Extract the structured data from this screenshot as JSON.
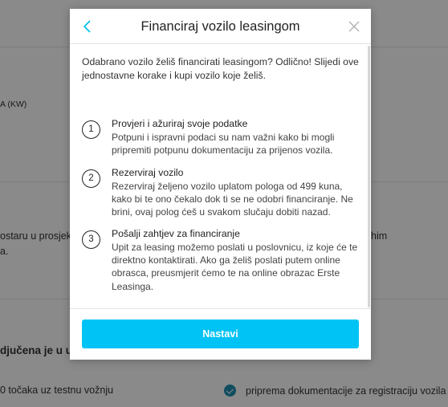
{
  "background": {
    "power_label": "A (KW)",
    "left_snippet_1": "ostaru u prosjek",
    "left_snippet_2": "a.",
    "right_snippet": "him",
    "section_heading": "djučena je u uku",
    "bullet_left": "0 točaka uz testnu vožnju",
    "bullet_right": "priprema dokumentacije za registraciju vozila"
  },
  "modal": {
    "title": "Financiraj vozilo leasingom",
    "back_icon": "chevron-left-icon",
    "close_icon": "close-icon",
    "intro": "Odabrano vozilo želiš financirati leasingom? Odlično! Slijedi ove jednostavne korake i kupi vozilo koje želiš.",
    "steps": [
      {
        "number": "1",
        "title": "Provjeri i ažuriraj svoje podatke",
        "text": "Potpuni i ispravni podaci su nam važni kako bi mogli pripremiti potpunu dokumentaciju za prijenos vozila."
      },
      {
        "number": "2",
        "title": "Rezerviraj vozilo",
        "text": "Rezerviraj željeno vozilo uplatom pologa od 499 kuna, kako bi te ono čekalo dok ti se ne odobri financiranje. Ne brini, ovaj polog ćeš u svakom slučaju dobiti nazad."
      },
      {
        "number": "3",
        "title": "Pošalji zahtjev za financiranje",
        "text": "Upit za leasing možemo poslati u poslovnicu, iz koje će te direktno kontaktirati. Ako ga želiš poslati putem online obrasca, preusmjerit ćemo te na online obrazac Erste Leasinga."
      }
    ],
    "primary_button": "Nastavi",
    "accent_color": "#00c3f5"
  }
}
